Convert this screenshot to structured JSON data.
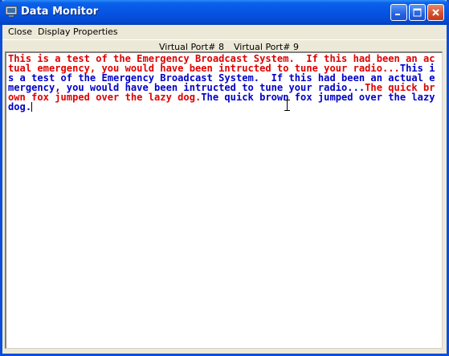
{
  "window": {
    "title": "Data Monitor"
  },
  "menu": {
    "items": [
      "Close",
      "Display Properties"
    ]
  },
  "ports": {
    "port_a": "Virtual Port# 8",
    "port_b": "Virtual Port# 9"
  },
  "monitor": {
    "segments": [
      {
        "text": "This is a test of the Emergency Broadcast System.  If this had been an actual emergency, you would have been intructed to tune your radio...",
        "color": "#E00000"
      },
      {
        "text": "This is a test of the Emergency Broadcast System.  If this had been an actual emergency, you would have been intructed to tune your radio...",
        "color": "#0000C8"
      },
      {
        "text": "The quick brown fox jumped over the lazy dog.",
        "color": "#E00000"
      },
      {
        "text": "The quick brown fox jumped over the lazy dog.",
        "color": "#0000C8"
      }
    ]
  },
  "icons": [
    "app-icon",
    "minimize-icon",
    "maximize-icon",
    "close-icon",
    "text-cursor-icon"
  ]
}
